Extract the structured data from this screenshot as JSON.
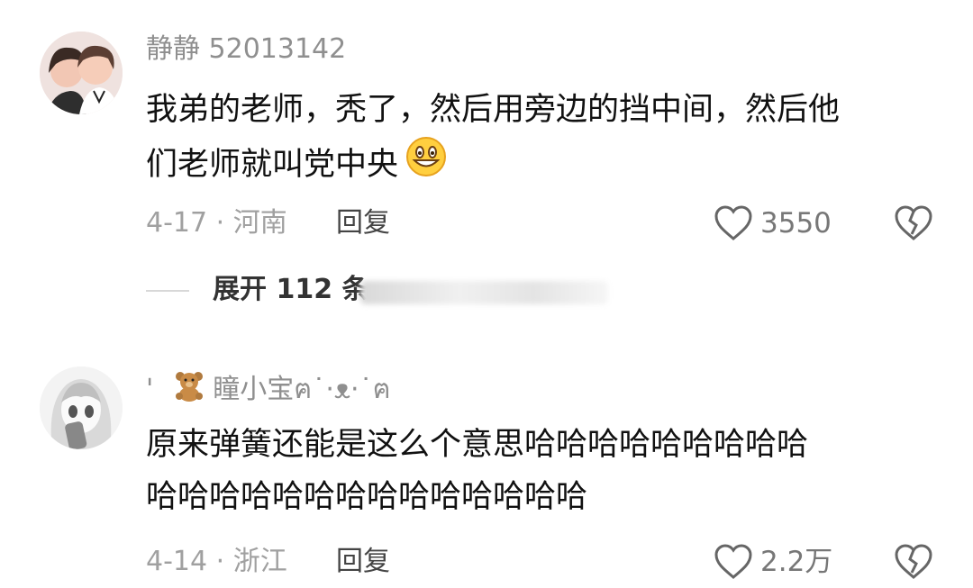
{
  "comments": [
    {
      "username": "静静 52013142",
      "text_line1": "我弟的老师，秃了，然后用旁边的挡中间，然后他",
      "text_line2": "们老师就叫党中央",
      "meta": "4-17 · 河南",
      "reply": "回复",
      "likes": "3550"
    },
    {
      "username_prefix": "'",
      "username": "瞳小宝ฅ˙·ᴥ·˙ฅ",
      "text_line1": "原来弹簧还能是这么个意思哈哈哈哈哈哈哈哈哈",
      "text_line2": "哈哈哈哈哈哈哈哈哈哈哈哈哈哈",
      "meta": "4-14 · 浙江",
      "reply": "回复",
      "likes": "2.2万"
    }
  ],
  "expand": {
    "label": "展开 112 条"
  },
  "icons": {
    "like": "heart-outline-icon",
    "dislike": "broken-heart-icon",
    "emoji": "grinning-face-emoji",
    "bear": "teddy-bear-emoji"
  }
}
